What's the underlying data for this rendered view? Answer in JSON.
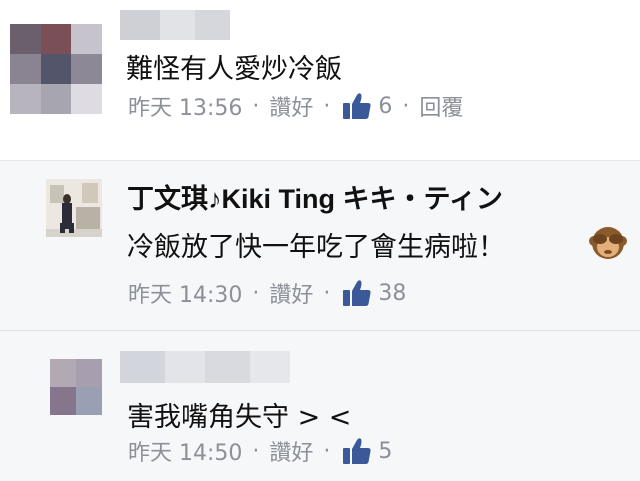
{
  "comments": [
    {
      "author_blurred": true,
      "text": "難怪有人愛炒冷飯",
      "time": "昨天 13:56",
      "like_label": "讚好",
      "like_count": "6",
      "reply_label": "回覆"
    },
    {
      "author": "丁文琪♪Kiki Ting キキ・ティン",
      "text": "冷飯放了快一年吃了會生病啦！",
      "emoji": "see-no-evil-monkey",
      "time": "昨天 14:30",
      "like_label": "讚好",
      "like_count": "38"
    },
    {
      "author_blurred": true,
      "text": "害我嘴角失守 > <",
      "time": "昨天 14:50",
      "like_label": "讚好",
      "like_count": "5"
    }
  ],
  "separator": "·",
  "colors": {
    "like_icon": "#3b5998",
    "meta_text": "#8b9099",
    "row_bg": "#f6f7f9"
  }
}
